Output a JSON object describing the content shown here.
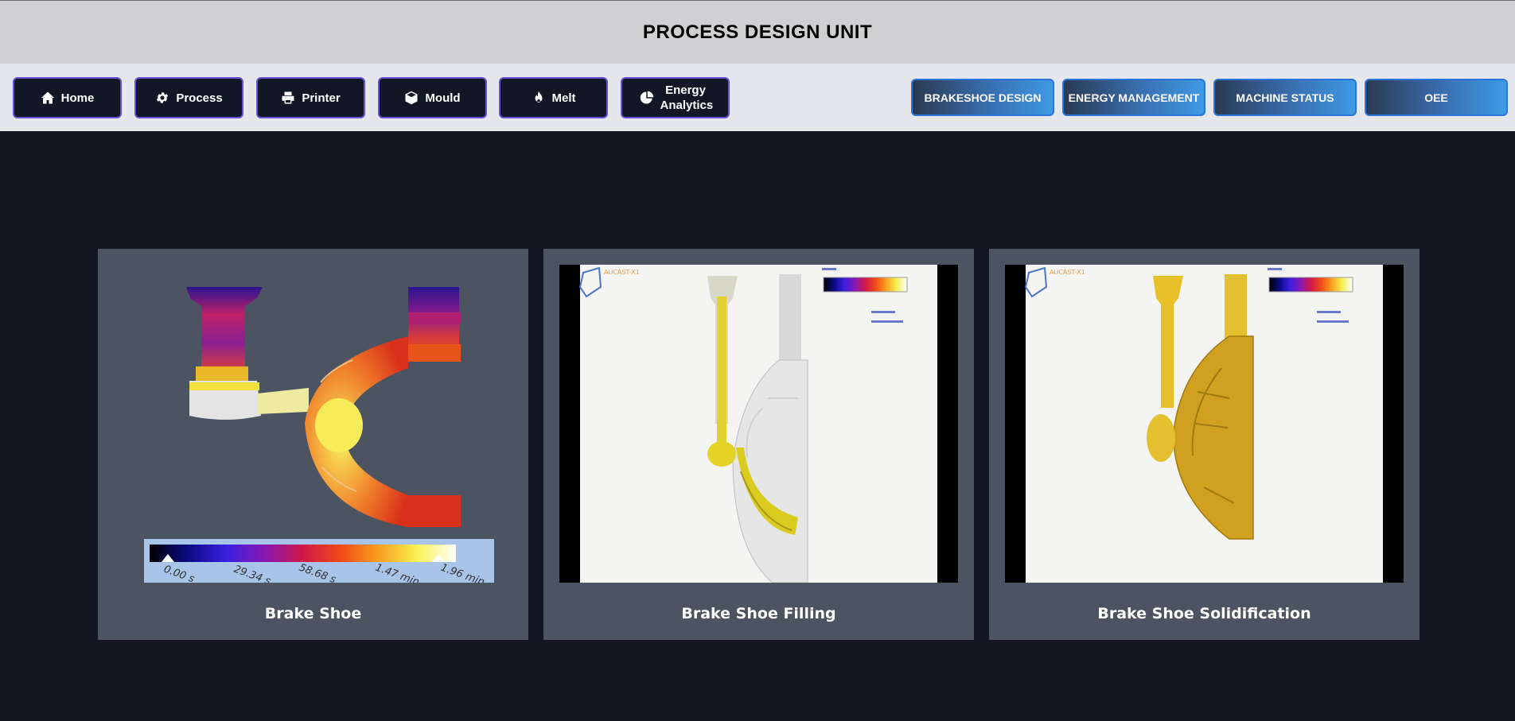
{
  "header": {
    "title": "PROCESS DESIGN UNIT"
  },
  "nav": {
    "items": [
      {
        "label": "Home",
        "icon": "home-icon"
      },
      {
        "label": "Process",
        "icon": "gear-icon"
      },
      {
        "label": "Printer",
        "icon": "printer-icon"
      },
      {
        "label": "Mould",
        "icon": "cube-icon"
      },
      {
        "label": "Melt",
        "icon": "fire-icon"
      },
      {
        "label": "Energy Analytics",
        "icon": "pie-chart-icon"
      }
    ],
    "units": [
      {
        "label": "BRAKESHOE DESIGN"
      },
      {
        "label": "ENERGY MANAGEMENT"
      },
      {
        "label": "MACHINE STATUS"
      },
      {
        "label": "OEE"
      }
    ]
  },
  "cards": [
    {
      "caption": "Brake Shoe",
      "legend_ticks": [
        "0.00 s",
        "29.34 s",
        "58.68 s",
        "1.47 min",
        "1.96 min"
      ]
    },
    {
      "caption": "Brake Shoe Filling",
      "logo_text": "AUCAST-X1"
    },
    {
      "caption": "Brake Shoe Solidification",
      "logo_text": "AUCAST-X1"
    }
  ],
  "colors": {
    "page_bg": "#141722",
    "header_bg": "#d0d0d2",
    "nav_bg": "#e6e7ec",
    "nav_button_bg": "#121726",
    "nav_button_border": "#6a4fd8",
    "unit_button_border": "#2b74d8",
    "card_bg": "#4c5462"
  }
}
